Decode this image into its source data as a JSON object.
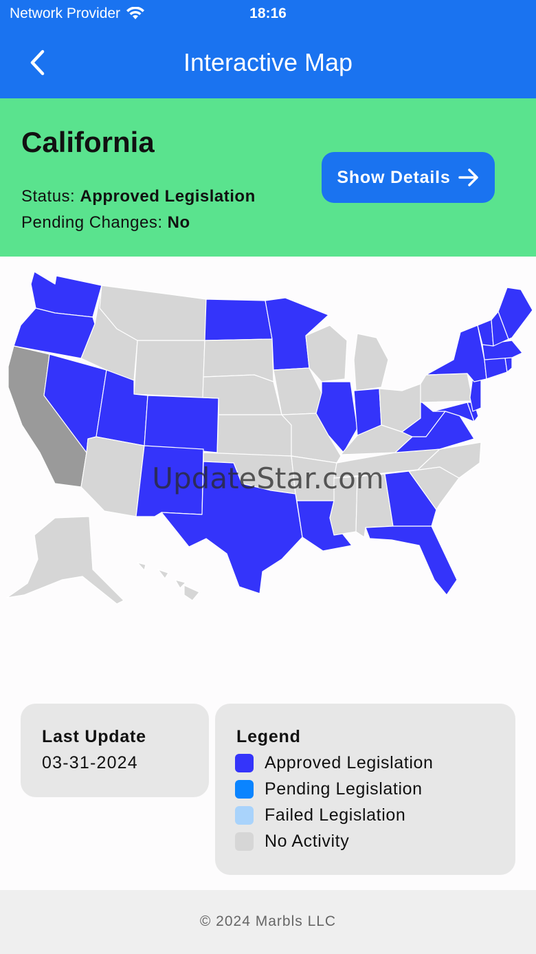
{
  "status_bar": {
    "carrier": "Network Provider",
    "time": "18:16"
  },
  "nav": {
    "title": "Interactive Map"
  },
  "state_panel": {
    "name": "California",
    "status_label": "Status:",
    "status_value": "Approved Legislation",
    "pending_label": "Pending Changes:",
    "pending_value": "No",
    "details_button": "Show Details"
  },
  "map": {
    "watermark": "UpdateStar.com",
    "selected_state": "California",
    "states": {
      "WA": "approved",
      "OR": "approved",
      "CA": "selected",
      "NV": "approved",
      "UT": "approved",
      "CO": "approved",
      "NM": "approved",
      "TX": "approved",
      "ND": "approved",
      "MN": "approved",
      "IL": "approved",
      "IN": "approved",
      "LA": "approved",
      "GA": "approved",
      "FL": "approved",
      "WV": "approved",
      "VA": "approved",
      "MD": "approved",
      "NJ": "approved",
      "NY": "approved",
      "VT": "approved",
      "NH": "approved",
      "ME": "approved",
      "MA": "approved",
      "CT": "approved",
      "RI": "approved",
      "DE": "approved",
      "ID": "none",
      "MT": "none",
      "WY": "none",
      "AZ": "none",
      "SD": "none",
      "NE": "none",
      "KS": "none",
      "OK": "none",
      "IA": "none",
      "MO": "none",
      "AR": "none",
      "MS": "none",
      "AL": "none",
      "TN": "none",
      "KY": "none",
      "WI": "none",
      "MI": "none",
      "OH": "none",
      "PA": "none",
      "NC": "none",
      "SC": "none",
      "AK": "none",
      "HI": "none"
    }
  },
  "last_update": {
    "title": "Last Update",
    "date": "03-31-2024"
  },
  "legend": {
    "title": "Legend",
    "items": [
      {
        "label": "Approved Legislation",
        "color": "#3434fa"
      },
      {
        "label": "Pending Legislation",
        "color": "#0a84ff"
      },
      {
        "label": "Failed Legislation",
        "color": "#a9d3fb"
      },
      {
        "label": "No Activity",
        "color": "#d6d6d6"
      }
    ]
  },
  "colors": {
    "header": "#1a73f0",
    "panel": "#5ae38e",
    "approved": "#3434fa",
    "none": "#d6d6d6",
    "selected": "#9a9a9a"
  },
  "footer": {
    "copyright": "© 2024 Marbls LLC"
  }
}
